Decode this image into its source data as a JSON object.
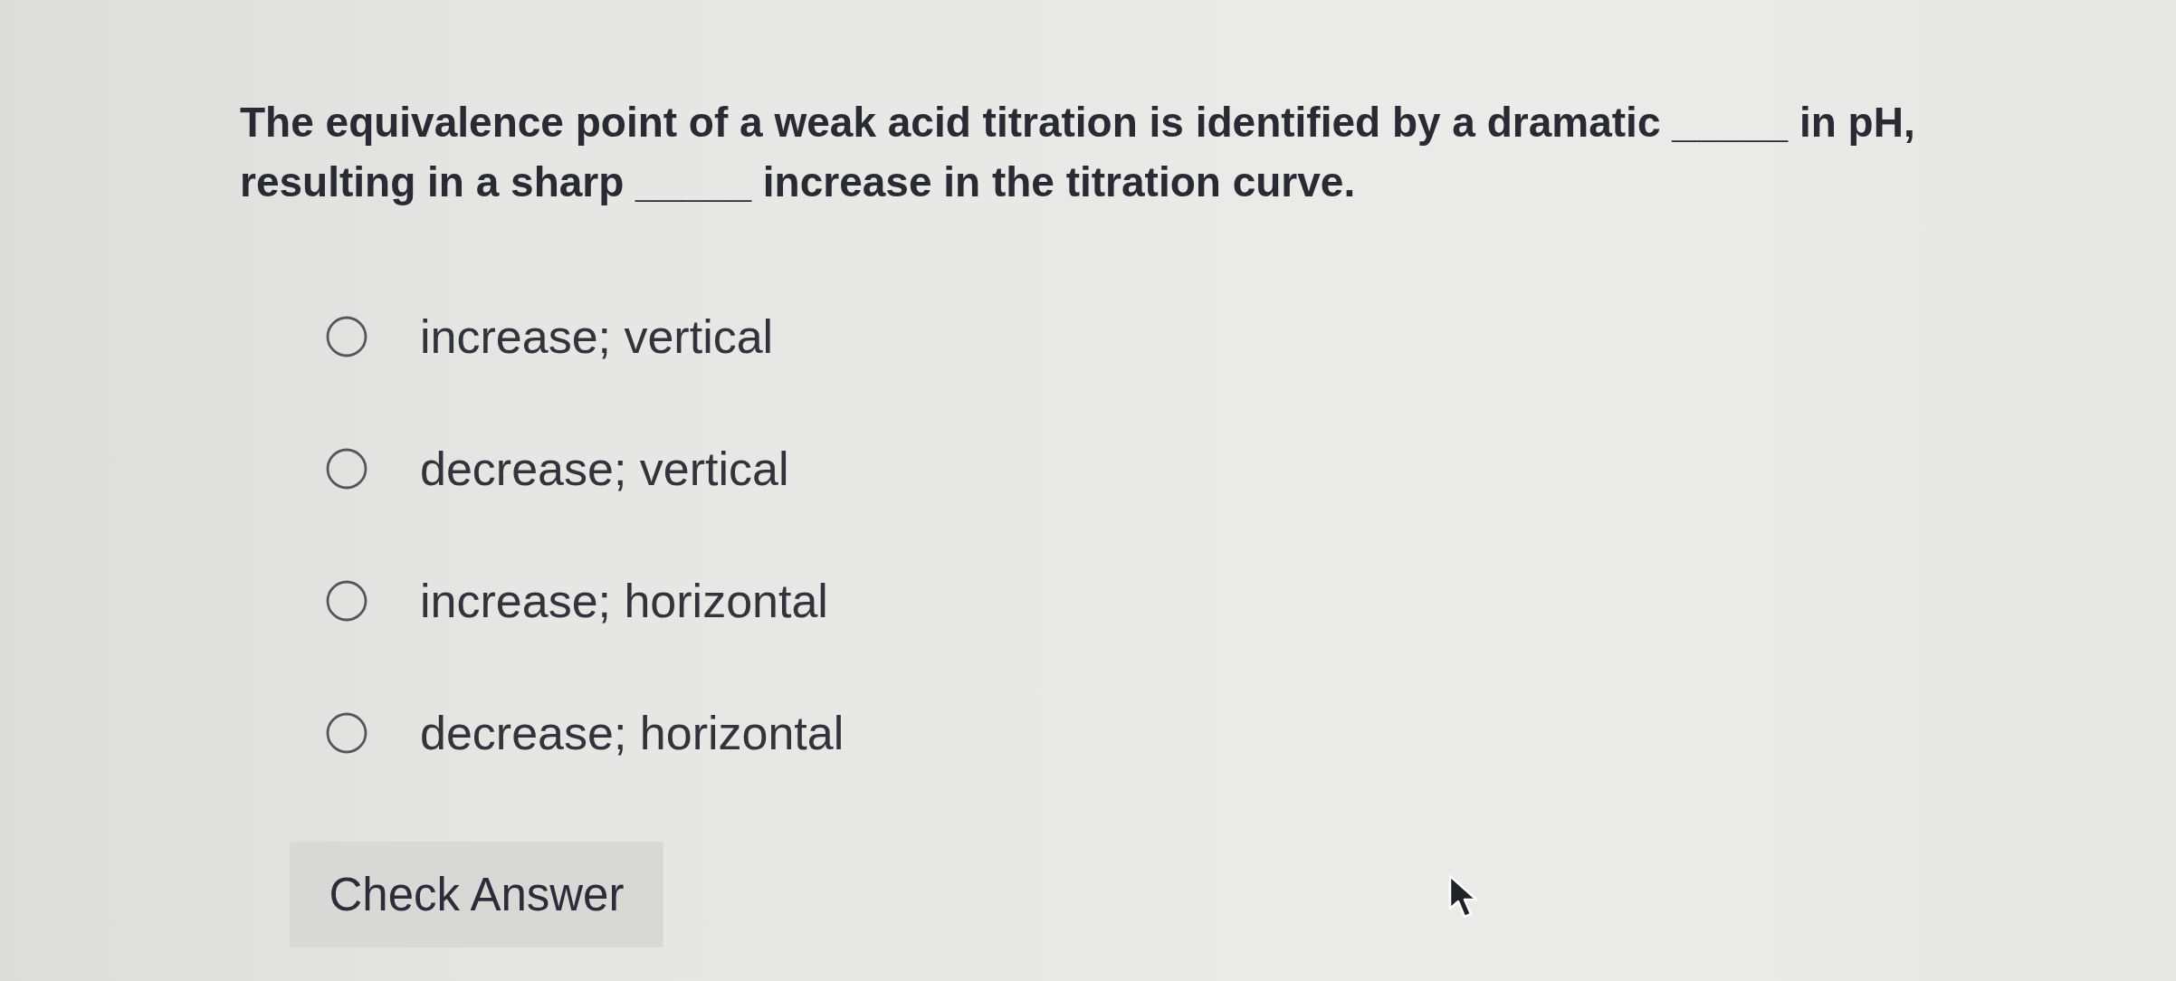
{
  "question": {
    "text": "The equivalence point of a weak acid titration is identified by a dramatic _____ in pH, resulting in a sharp _____ increase in the titration curve."
  },
  "options": [
    {
      "label": "increase; vertical",
      "selected": false
    },
    {
      "label": "decrease; vertical",
      "selected": false
    },
    {
      "label": "increase; horizontal",
      "selected": false
    },
    {
      "label": "decrease; horizontal",
      "selected": false
    }
  ],
  "check_button": {
    "label": "Check Answer"
  }
}
